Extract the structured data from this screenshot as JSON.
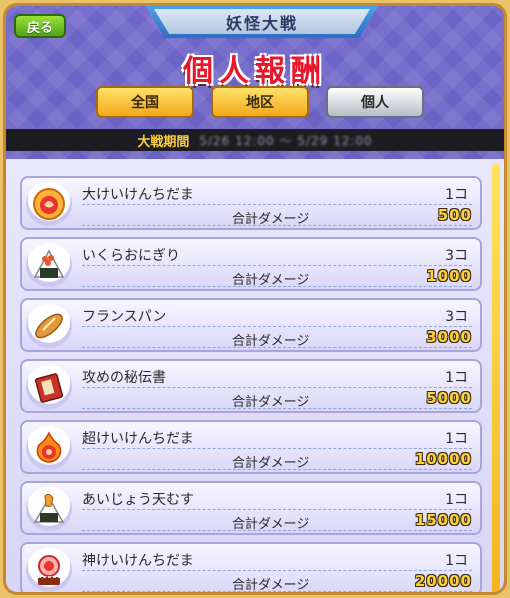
{
  "header": {
    "back_label": "戻る",
    "banner_title": "妖怪大戦",
    "page_title": "個人報酬"
  },
  "tabs": [
    {
      "label": "全国",
      "selected": false
    },
    {
      "label": "地区",
      "selected": false
    },
    {
      "label": "個人",
      "selected": true
    }
  ],
  "period": {
    "label": "大戦期間",
    "value": "5/26 12:00 ～ 5/29 12:00"
  },
  "damage_label": "合計ダメージ",
  "rewards": [
    {
      "name": "大けいけんちだま",
      "qty": "1コ",
      "damage": "500",
      "icon": "orb-icon"
    },
    {
      "name": "いくらおにぎり",
      "qty": "3コ",
      "damage": "1000",
      "icon": "onigiri-icon"
    },
    {
      "name": "フランスパン",
      "qty": "3コ",
      "damage": "3000",
      "icon": "bread-icon"
    },
    {
      "name": "攻めの秘伝書",
      "qty": "1コ",
      "damage": "5000",
      "icon": "scroll-book-icon"
    },
    {
      "name": "超けいけんちだま",
      "qty": "1コ",
      "damage": "10000",
      "icon": "flame-orb-icon"
    },
    {
      "name": "あいじょう天むす",
      "qty": "1コ",
      "damage": "15000",
      "icon": "tenmusu-icon"
    },
    {
      "name": "神けいけんちだま",
      "qty": "1コ",
      "damage": "20000",
      "icon": "god-orb-icon"
    }
  ],
  "colors": {
    "accent_title": "#e8172b",
    "damage_value": "#ffd23a",
    "background": "#6e65c8"
  }
}
